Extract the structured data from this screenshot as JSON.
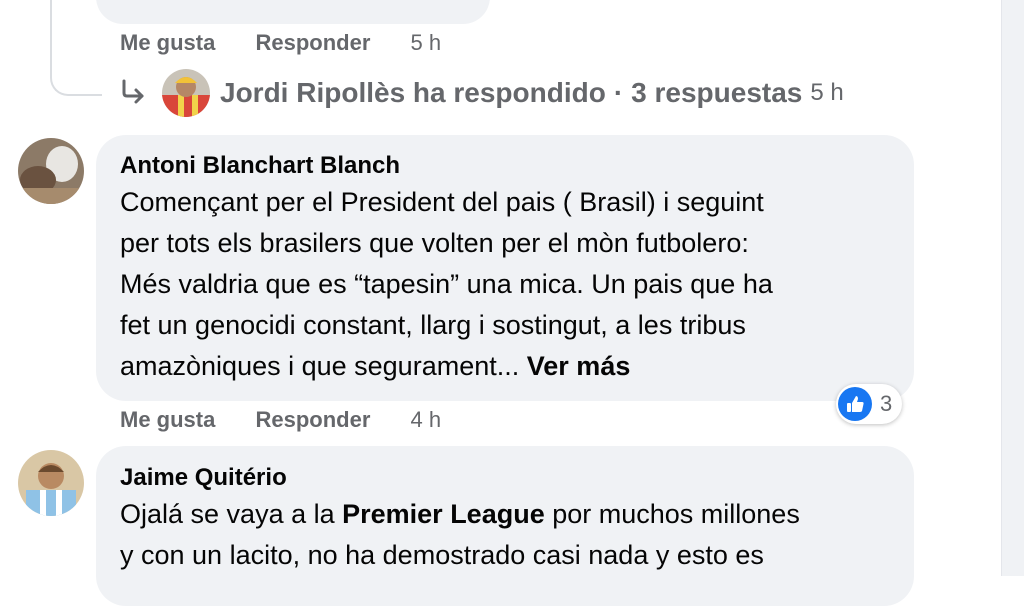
{
  "top_comment": {
    "actions": {
      "like": "Me gusta",
      "reply": "Responder",
      "time": "5 h"
    },
    "replies_summary": {
      "name": "Jordi Ripollès ha respondido",
      "separator": "·",
      "count": "3 respuestas",
      "time": "5 h"
    }
  },
  "comments": [
    {
      "author": "Antoni Blanchart Blanch",
      "lines": [
        "Començant per el President del pais ( Brasil) i seguint",
        "per tots els brasilers que volten per el mòn futbolero:",
        "Més valdria que es “tapesin” una mica. Un pais que ha",
        "fet un genocidi constant, llarg i sostingut, a les tribus",
        "amazòniques i que segurament..."
      ],
      "see_more": "Ver más",
      "actions": {
        "like": "Me gusta",
        "reply": "Responder",
        "time": "4 h"
      },
      "reaction_count": "3"
    },
    {
      "author": "Jaime Quitério",
      "line1_pre": "Ojalá se vaya a la ",
      "line1_bold": "Premier League",
      "line1_post": " por muchos millones",
      "line2": "y con un lacito, no ha demostrado casi nada y esto es"
    }
  ],
  "icons": [
    "reply-arrow-icon",
    "like-reaction-icon"
  ],
  "colors": {
    "bubble": "#f0f2f5",
    "meta": "#65676b",
    "like_blue": "#1877f2"
  }
}
